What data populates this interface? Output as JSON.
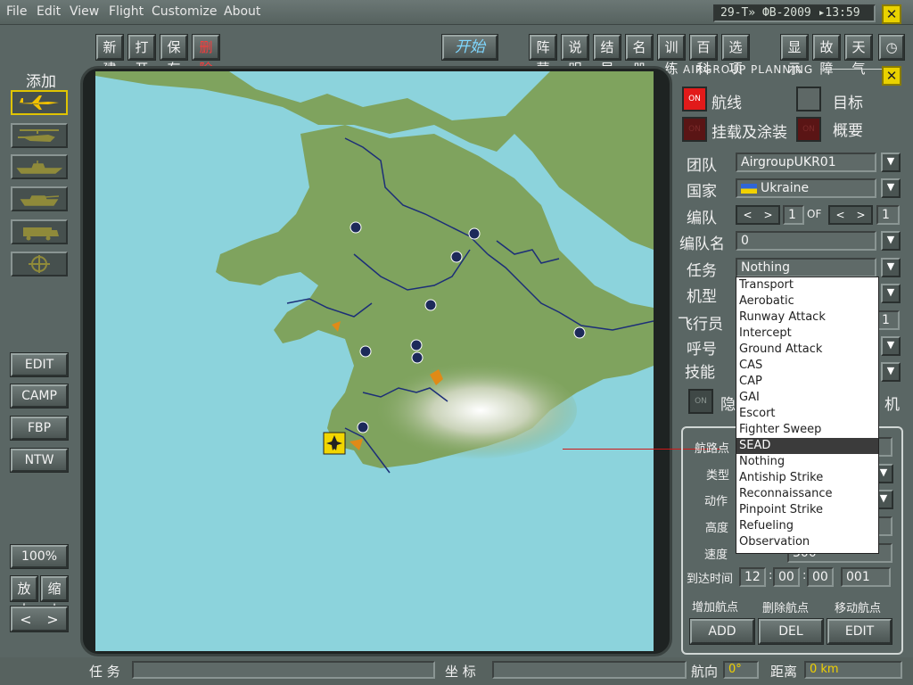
{
  "menu": {
    "file": "File",
    "edit": "Edit",
    "view": "View",
    "flight": "Flight",
    "customize": "Customize",
    "about": "About"
  },
  "clock": "29-Т» ФВ-2009 ▸13:59",
  "toolbar": {
    "new": "新建",
    "open": "打开",
    "save": "保存",
    "delete": "删除",
    "start": "开始",
    "camp": "阵营",
    "explain": "说明",
    "result": "结局",
    "roster": "名册",
    "train": "训练",
    "wiki": "百科",
    "options": "选项",
    "display": "显示",
    "failure": "故障",
    "weather": "天气"
  },
  "left": {
    "add_label": "添加",
    "units": [
      "aircraft-icon",
      "helicopter-icon",
      "ship-icon",
      "tank-icon",
      "truck-icon",
      "target-icon"
    ],
    "edit": "EDIT",
    "camp": "CAMP",
    "fbp": "FBP",
    "ntw": "NTW",
    "zoom": "100%",
    "zoom_in": "放大",
    "zoom_out": "缩小"
  },
  "panel": {
    "title": "AIRGROUP PLANNING",
    "route_label": "航线",
    "target_label": "目标",
    "loadout_label": "挂载及涂装",
    "summary_label": "概要",
    "on_text": "ON",
    "group_label": "团队",
    "group_value": "AirgroupUKR01",
    "country_label": "国家",
    "country_value": "Ukraine",
    "formation_label": "编队",
    "formation_value": "1",
    "of_text": "OF",
    "formation_of_value": "1",
    "formation_name_label": "编队名",
    "formation_name_value": "0",
    "mission_label": "任务",
    "mission_value": "Nothing",
    "aircraft_label": "机型",
    "pilot_label": "飞行员",
    "pilot_value": "1",
    "callsign_label": "呼号",
    "skill_label": "技能",
    "hidden_label": "隐",
    "hidden_suffix": "机"
  },
  "mission_options": [
    "Transport",
    "Aerobatic",
    "Runway Attack",
    "Intercept",
    "Ground Attack",
    "CAS",
    "CAP",
    "GAI",
    "Escort",
    "Fighter Sweep",
    "SEAD",
    "Nothing",
    "Antiship Strike",
    "Reconnaissance",
    "Pinpoint Strike",
    "Refueling",
    "Observation"
  ],
  "mission_selected_index": 10,
  "waypoint": {
    "wp_label": "航路点",
    "type_label": "类型",
    "action_label": "动作",
    "alt_label": "高度",
    "speed_label": "速度",
    "speed_value": "300",
    "arrival_label": "到达时间",
    "hh": "12",
    "mm": "00",
    "ss": "00",
    "ms": "001",
    "add_label": "增加航点",
    "del_label": "删除航点",
    "move_label": "移动航点",
    "add_btn": "ADD",
    "del_btn": "DEL",
    "edit_btn": "EDIT"
  },
  "bottom": {
    "task_label": "任 务",
    "coord_label": "坐 标",
    "heading_label": "航向",
    "heading_value": "0°",
    "distance_label": "距离",
    "distance_value": "0 km"
  },
  "colors": {
    "land": "#7fa35e",
    "sea": "#8cd3dc",
    "river": "#1c2e78",
    "airfield": "#1d2a5a"
  }
}
